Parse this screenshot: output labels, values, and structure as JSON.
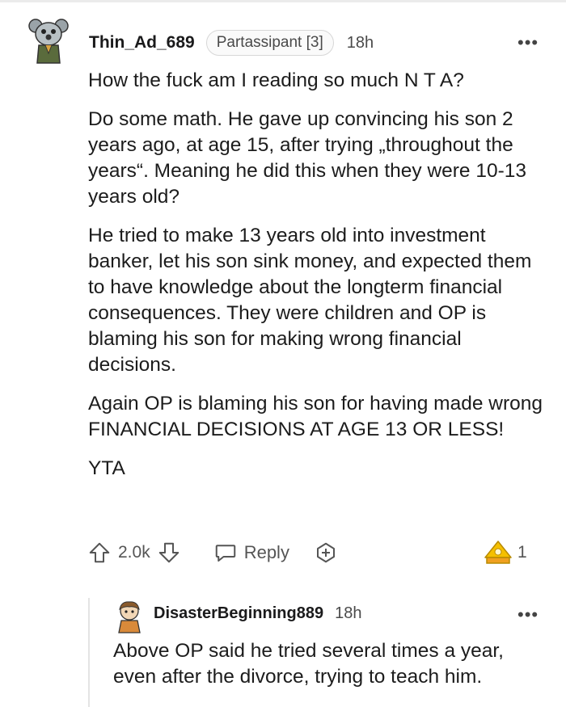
{
  "comment": {
    "username": "Thin_Ad_689",
    "flair": "Partassipant [3]",
    "time": "18h",
    "more": "•••",
    "paragraphs": [
      "How the fuck am I reading so much N T A?",
      "Do some math. He gave up convincing his son 2 years ago, at age 15, after trying „throughout the years“. Meaning he did this when they were 10-13 years old?",
      "He tried to make 13 years old into investment banker, let his son sink money, and expected them to have knowledge about the longterm financial consequences. They were children and OP is blaming his son for making wrong financial decisions.",
      "Again OP is blaming his son for having made wrong FINANCIAL DECISIONS AT AGE 13 OR LESS!",
      "YTA"
    ],
    "score": "2.0k",
    "reply_label": "Reply",
    "award_count": "1",
    "icons": [
      "upvote-icon",
      "downvote-icon",
      "reply-icon",
      "add-award-icon",
      "award-icon",
      "avatar"
    ]
  },
  "reply": {
    "username": "DisasterBeginning889",
    "time": "18h",
    "more": "•••",
    "text": "Above OP said he tried several times a year, even after the divorce, trying to teach him."
  },
  "colors": {
    "text": "#1a1a1b",
    "muted": "#555555",
    "award": "#f5c000"
  }
}
